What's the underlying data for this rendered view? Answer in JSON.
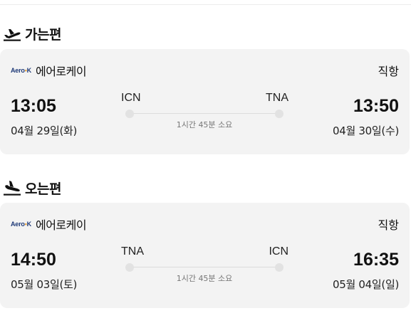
{
  "outbound": {
    "section_title": "가는편",
    "icon": "airplane-takeoff-icon",
    "airline_logo": "Aero K",
    "airline_name": "에어로케이",
    "flight_type": "직항",
    "departure": {
      "code": "ICN",
      "time": "13:05",
      "date": "04월 29일(화)"
    },
    "arrival": {
      "code": "TNA",
      "time": "13:50",
      "date": "04월 30일(수)"
    },
    "duration": "1시간 45분 소요"
  },
  "inbound": {
    "section_title": "오는편",
    "icon": "airplane-landing-icon",
    "airline_logo": "Aero K",
    "airline_name": "에어로케이",
    "flight_type": "직항",
    "departure": {
      "code": "TNA",
      "time": "14:50",
      "date": "05월 03일(토)"
    },
    "arrival": {
      "code": "ICN",
      "time": "16:35",
      "date": "05월 04일(일)"
    },
    "duration": "1시간 45분 소요"
  },
  "colors": {
    "card_background": "#f3f3f3",
    "logo_blue": "#1f3a78",
    "logo_accent": "#e8a33a"
  }
}
